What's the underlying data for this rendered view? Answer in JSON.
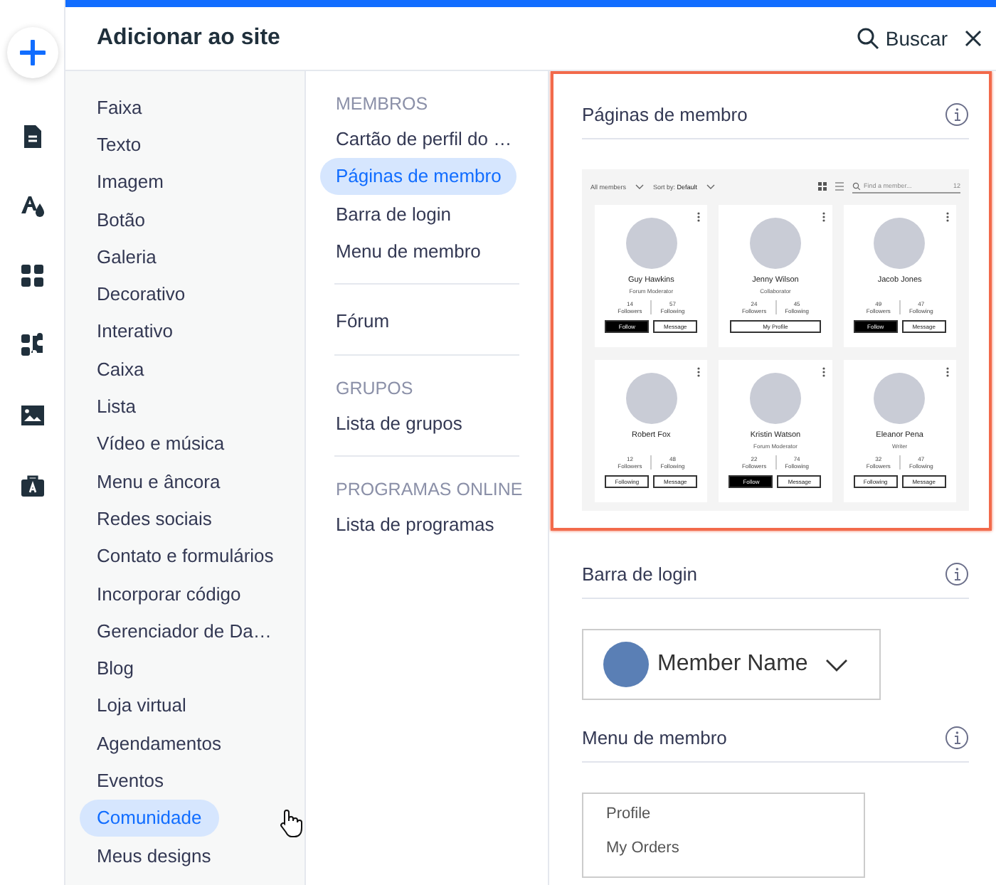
{
  "header": {
    "title": "Adicionar ao site",
    "search_label": "Buscar"
  },
  "categories": [
    {
      "label": "Faixa",
      "selected": false
    },
    {
      "label": "Texto",
      "selected": false
    },
    {
      "label": "Imagem",
      "selected": false
    },
    {
      "label": "Botão",
      "selected": false
    },
    {
      "label": "Galeria",
      "selected": false
    },
    {
      "label": "Decorativo",
      "selected": false
    },
    {
      "label": "Interativo",
      "selected": false
    },
    {
      "label": "Caixa",
      "selected": false
    },
    {
      "label": "Lista",
      "selected": false
    },
    {
      "label": "Vídeo e música",
      "selected": false
    },
    {
      "label": "Menu e âncora",
      "selected": false
    },
    {
      "label": "Redes sociais",
      "selected": false
    },
    {
      "label": "Contato e formulários",
      "selected": false
    },
    {
      "label": "Incorporar código",
      "selected": false
    },
    {
      "label": "Gerenciador de Da…",
      "selected": false
    },
    {
      "label": "Blog",
      "selected": false
    },
    {
      "label": "Loja virtual",
      "selected": false
    },
    {
      "label": "Agendamentos",
      "selected": false
    },
    {
      "label": "Eventos",
      "selected": false
    },
    {
      "label": "Comunidade",
      "selected": true
    },
    {
      "label": "Meus designs",
      "selected": false
    }
  ],
  "sections": [
    {
      "heading": "MEMBROS",
      "items": [
        {
          "label": "Cartão de perfil do …",
          "selected": false
        },
        {
          "label": "Páginas de membro",
          "selected": true
        },
        {
          "label": "Barra de login",
          "selected": false
        },
        {
          "label": "Menu de membro",
          "selected": false
        }
      ]
    },
    {
      "items": [
        {
          "label": "Fórum",
          "selected": false
        }
      ]
    },
    {
      "heading": "GRUPOS",
      "items": [
        {
          "label": "Lista de grupos",
          "selected": false
        }
      ]
    },
    {
      "heading": "PROGRAMAS ONLINE",
      "items": [
        {
          "label": "Lista de programas",
          "selected": false
        }
      ]
    }
  ],
  "previews": [
    {
      "kind": "member_pages",
      "title": "Páginas de membro",
      "selected": true,
      "filter": "All members",
      "sort_label": "Sort by:",
      "sort_value": "Default",
      "search_placeholder": "Find a member...",
      "count": "12",
      "members": [
        {
          "name": "Guy Hawkins",
          "badge": "Forum Moderator",
          "followers": "14",
          "followers_label": "Followers",
          "following": "57",
          "following_label": "Following",
          "buttons": [
            {
              "label": "Follow",
              "kind": "primary"
            },
            {
              "label": "Message",
              "kind": "secondary"
            }
          ]
        },
        {
          "name": "Jenny Wilson",
          "badge": "Collaborator",
          "followers": "24",
          "followers_label": "Followers",
          "following": "45",
          "following_label": "Following",
          "buttons": [
            {
              "label": "My Profile",
              "kind": "secondary"
            }
          ]
        },
        {
          "name": "Jacob Jones",
          "followers": "49",
          "followers_label": "Followers",
          "following": "47",
          "following_label": "Following",
          "buttons": [
            {
              "label": "Follow",
              "kind": "primary"
            },
            {
              "label": "Message",
              "kind": "secondary"
            }
          ]
        },
        {
          "name": "Robert Fox",
          "followers": "12",
          "followers_label": "Followers",
          "following": "48",
          "following_label": "Following",
          "buttons": [
            {
              "label": "Following",
              "kind": "secondary"
            },
            {
              "label": "Message",
              "kind": "secondary"
            }
          ]
        },
        {
          "name": "Kristin Watson",
          "badge": "Forum Moderator",
          "followers": "22",
          "followers_label": "Followers",
          "following": "74",
          "following_label": "Following",
          "buttons": [
            {
              "label": "Follow",
              "kind": "primary"
            },
            {
              "label": "Message",
              "kind": "secondary"
            }
          ]
        },
        {
          "name": "Eleanor Pena",
          "badge": "Writer",
          "followers": "32",
          "followers_label": "Followers",
          "following": "47",
          "following_label": "Following",
          "buttons": [
            {
              "label": "Following",
              "kind": "secondary"
            },
            {
              "label": "Message",
              "kind": "secondary"
            }
          ]
        }
      ]
    },
    {
      "kind": "login_bar",
      "title": "Barra de login",
      "selected": false,
      "member_name": "Member Name"
    },
    {
      "kind": "member_menu",
      "title": "Menu de membro",
      "selected": false,
      "items": [
        "Profile",
        "My Orders"
      ]
    }
  ]
}
